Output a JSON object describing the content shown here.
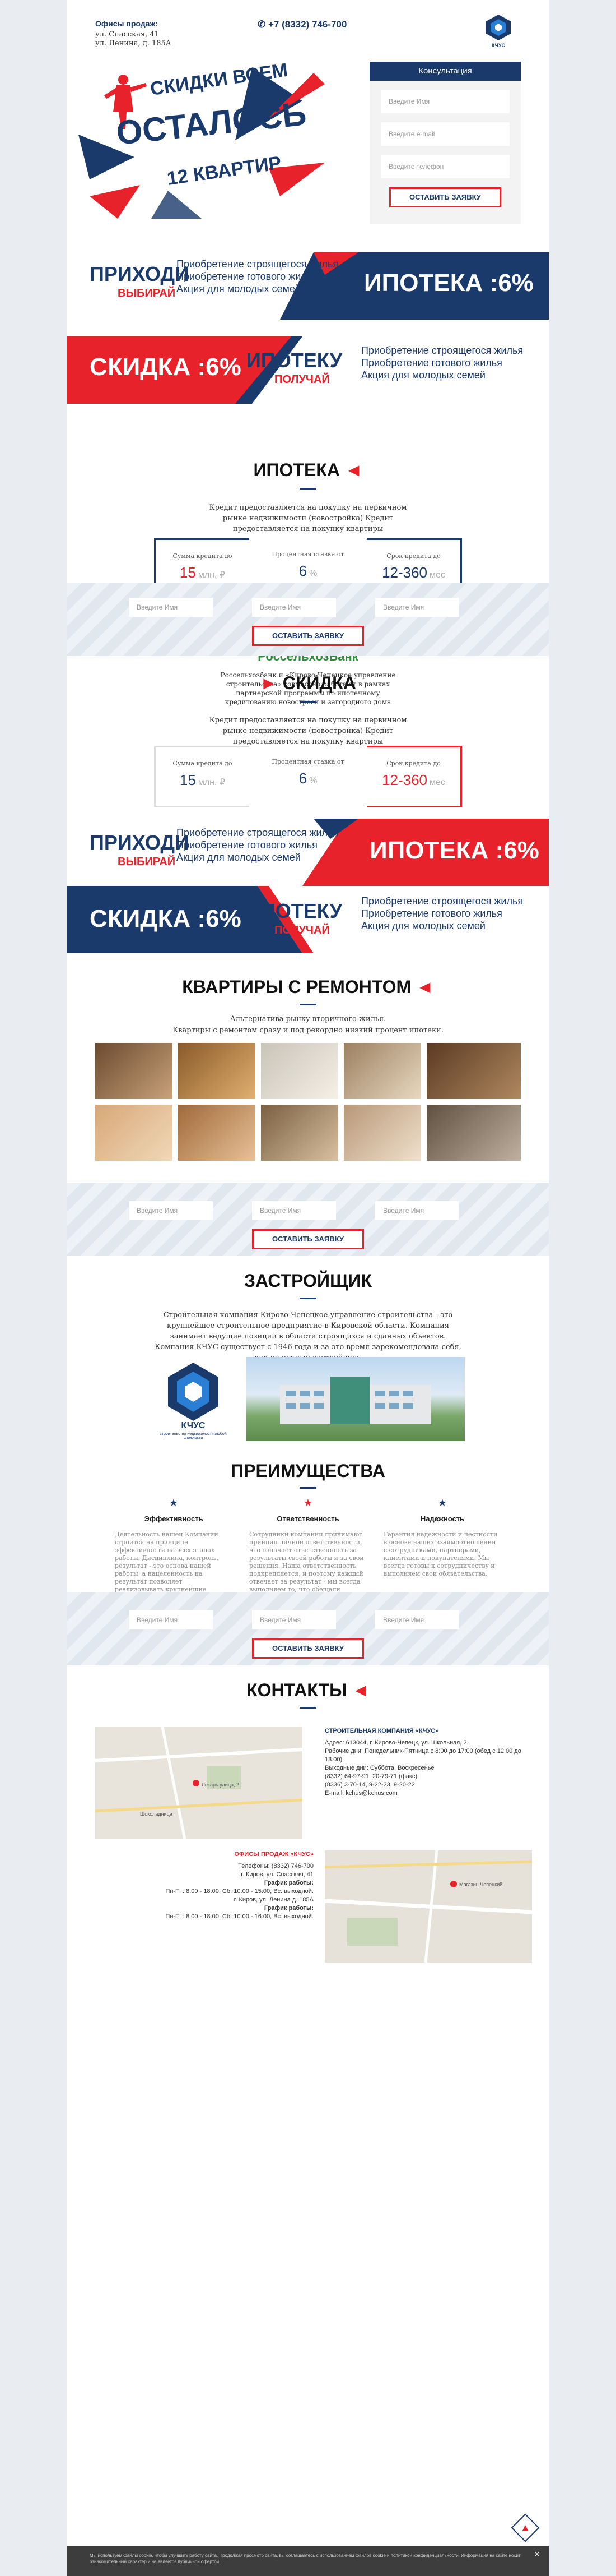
{
  "header": {
    "offices_title": "Офисы продаж:",
    "office_1": "ул. Спасская, 41",
    "office_2": "ул. Ленина, д. 185А",
    "phone": "+7 (8332) 746-700",
    "logo_text": "КЧУС"
  },
  "hero": {
    "line1": "СКИДКИ ВСЕМ",
    "line2": "ОСТАЛОСЬ",
    "line3": "12 КВАРТИР",
    "form_title": "Консультация",
    "name_placeholder": "Введите Имя",
    "email_placeholder": "Введите e-mail",
    "phone_placeholder": "Введите телефон",
    "submit": "ОСТАВИТЬ ЗАЯВКУ"
  },
  "banner_come": {
    "big": "ПРИХОДИ",
    "small": "ВЫБИРАЙ",
    "items": [
      "Приобретение строящегося жилья",
      "Приобретение готового жилья",
      "Акция для молодых семей"
    ],
    "promo": "ИПОТЕКА :6%"
  },
  "banner_discount": {
    "promo": "СКИДКА :6%",
    "big": "ИПОТЕКУ",
    "small": "ПОЛУЧАЙ",
    "items": [
      "Приобретение строящегося жилья",
      "Приобретение готового жилья",
      "Акция для молодых семей"
    ]
  },
  "mortgage": {
    "title": "ИПОТЕКА",
    "text": "Кредит предоставляется на покупку на первичном рынке недвижимости (новостройка) Кредит предоставляется на покупку квартиры",
    "amount_label": "Сумма кредита до",
    "amount_value": "15",
    "amount_unit": "млн. ₽",
    "rate_label": "Процентная ставка от",
    "rate_value": "6",
    "rate_unit": "%",
    "term_label": "Срок кредита до",
    "term_value": "12-360",
    "term_unit": "мес",
    "bank_name": "РоссельхозБанк",
    "bank_text": "Россельхозбанк и «Кирово-Чепецкое управление строительства» совместно работают в рамках партнерской программы по ипотечному кредитованию новостроек и загородного дома"
  },
  "form_strip": {
    "name": "Введите Имя",
    "email": "Введите Имя",
    "phone": "Введите Имя",
    "submit": "ОСТАВИТЬ ЗАЯВКУ"
  },
  "discount": {
    "title": "СКИДКА",
    "text": "Кредит предоставляется на покупку на первичном рынке недвижимости (новостройка) Кредит предоставляется на покупку квартиры",
    "amount_label": "Сумма кредита до",
    "amount_value": "15",
    "amount_unit": "млн. ₽",
    "rate_label": "Процентная ставка от",
    "rate_value": "6",
    "rate_unit": "%",
    "term_label": "Срок кредита до",
    "term_value": "12-360",
    "term_unit": "мес"
  },
  "banner_come_2": {
    "big": "ПРИХОДИ",
    "small": "ВЫБИРАЙ",
    "items": [
      "Приобретение строящегося жилья",
      "Приобретение готового жилья",
      "Акция для молодых семей"
    ],
    "promo": "ИПОТЕКА :6%"
  },
  "banner_discount_2": {
    "promo": "СКИДКА :6%",
    "big": "ИПОТЕКУ",
    "small": "ПОЛУЧАЙ",
    "items": [
      "Приобретение строящегося жилья",
      "Приобретение готового жилья",
      "Акция для молодых семей"
    ]
  },
  "apartments": {
    "title": "КВАРТИРЫ С РЕМОНТОМ",
    "text_1": "Альтернатива рынку вторичного жилья.",
    "text_2": "Квартиры с ремонтом сразу и под рекордно низкий процент ипотеки."
  },
  "developer": {
    "title": "ЗАСТРОЙЩИК",
    "text": "Строительная компания Кирово-Чепецкое управление строительства - это крупнейшее строительное предприятие в Кировской области. Компания занимает ведущие позиции в области строящихся и сданных объектов. Компания КЧУС существует с 1946 года и за это время зарекомендовала себя, как надежный застройщик.",
    "logo_name": "КЧУС",
    "logo_sub": "строительство недвижимости любой сложности"
  },
  "advantages": {
    "title": "ПРЕИМУЩЕСТВА",
    "items": [
      {
        "title": "Эффективность",
        "text": "Деятельность нашей Компании строится на принципе эффективности на всех этапах работы. Дисциплина, контроль, результат - это основа нашей работы, а нацеленность на результат позволяет реализовывать крупнейшие проекты на рынке."
      },
      {
        "title": "Ответственность",
        "text": "Сотрудники компании принимают принцип личной ответственности, что означает ответственность за результаты своей работы и за свои решения. Наша ответственность подкрепляется, и поэтому каждый отвечает за результат - мы всегда выполняем то, что обещали клиенту."
      },
      {
        "title": "Надежность",
        "text": "Гарантия надежности и честности в основе наших взаимоотношений с сотрудниками, партнерами, клиентами и покупателями. Мы всегда готовы к сотрудничеству и выполняем свои обязательства."
      }
    ]
  },
  "contacts": {
    "title": "КОНТАКТЫ",
    "company_label": "СТРОИТЕЛЬНАЯ КОМПАНИЯ «КЧУС»",
    "address": "Адрес: 613044, г. Кирово-Чепецк, ул. Школьная, 2",
    "workdays": "Рабочие дни: Понедельник-Пятница с 8:00 до 17:00 (обед с 12:00 до 13:00)",
    "weekend": "Выходные дни: Суббота, Воскресенье",
    "phone_1": "(8332) 64-97-91, 20-79-71 (факс)",
    "phone_2": "(8336) 3-70-14, 9-22-23, 9-20-22",
    "email": "E-mail: kchus@kchus.com",
    "offices_label": "ОФИСЫ ПРОДАЖ «КЧУС»",
    "office_phones": "Телефоны: (8332) 746-700",
    "office_addr_1": "г. Киров, ул. Спасская, 41",
    "office_hours_label": "График работы:",
    "office_hours_1": "Пн-Пт: 8:00 - 18:00, Сб: 10:00 - 15:00, Вс: выходной.",
    "office_addr_2": "г. Киров, ул. Ленина д. 185А",
    "office_hours_2": "Пн-Пт: 8:00 - 18:00, Сб: 10:00 - 16:00, Вс: выходной.",
    "map_label_1": "Лекарь улица, 2",
    "map_label_2": "Шоколадница",
    "map_label_3": "Магазин Чепецкий"
  },
  "footer": {
    "text": "Мы используем файлы cookie, чтобы улучшить работу сайта. Продолжая просмотр сайта, вы соглашаетесь с использованием файлов cookie и политикой конфиденциальности. Информация на сайте носит ознакомительный характер и не является публичной офертой."
  },
  "colors": {
    "navy": "#1a3a6b",
    "red": "#e8222b"
  }
}
